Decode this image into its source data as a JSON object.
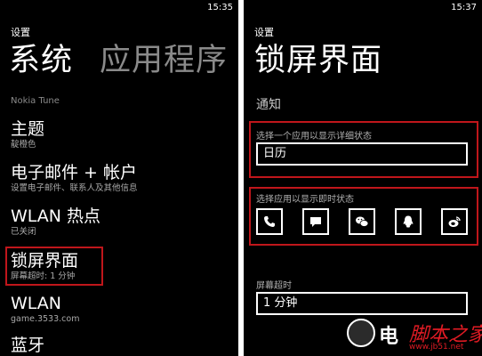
{
  "left": {
    "time": "15:35",
    "app_title": "设置",
    "pivot_active": "系统",
    "pivot_next": "应用程序",
    "section_label": "Nokia Tune",
    "items": [
      {
        "title": "主题",
        "subtitle": "靛橙色"
      },
      {
        "title": "电子邮件 + 帐户",
        "subtitle": "设置电子邮件、联系人及其他信息"
      },
      {
        "title": "WLAN 热点",
        "subtitle": "已关闭"
      },
      {
        "title": "锁屏界面",
        "subtitle": "屏幕超时: 1 分钟"
      },
      {
        "title": "WLAN",
        "subtitle": "game.3533.com"
      },
      {
        "title": "蓝牙",
        "subtitle": ""
      }
    ]
  },
  "right": {
    "time": "15:37",
    "app_title": "设置",
    "page_title": "锁屏界面",
    "section_notify": "通知",
    "detail_label": "选择一个应用以显示详细状态",
    "detail_value": "日历",
    "quick_label": "选择应用以显示即时状态",
    "quick_icons": [
      "phone-icon",
      "message-icon",
      "wechat-icon",
      "qq-icon",
      "weibo-icon"
    ],
    "timeout_label": "屏幕超时",
    "timeout_value": "1 分钟"
  },
  "watermark": {
    "brand": "电",
    "logo_text": "脚本之家",
    "url": "www.jb51.net"
  },
  "colors": {
    "background": "#000000",
    "highlight": "#c0161b",
    "text": "#ffffff",
    "subtext": "#a8a8a8"
  }
}
